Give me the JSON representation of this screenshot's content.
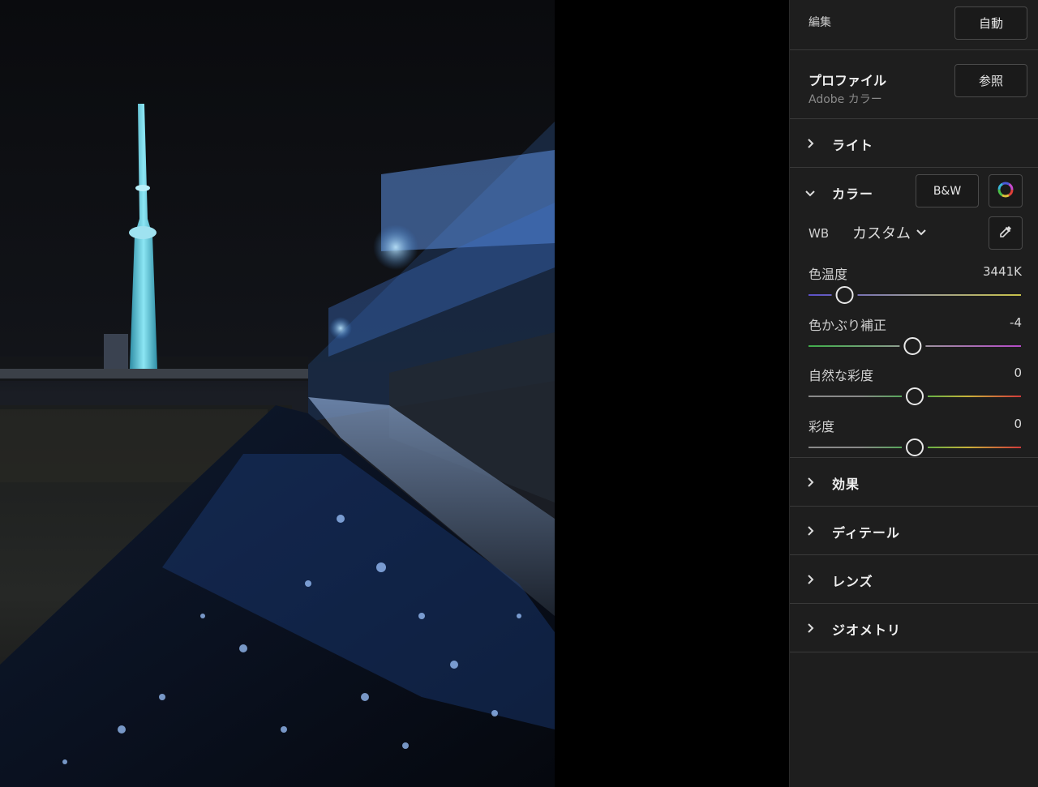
{
  "edit": {
    "title": "編集",
    "auto_label": "自動"
  },
  "profile": {
    "title": "プロファイル",
    "value": "Adobe カラー",
    "browse_label": "参照"
  },
  "sections": {
    "light": "ライト",
    "color": "カラー",
    "effects": "効果",
    "detail": "ディテール",
    "lens": "レンズ",
    "geometry": "ジオメトリ"
  },
  "color": {
    "bw_label": "B&W",
    "mixer_icon": "color-wheel-icon",
    "wb_label": "WB",
    "wb_value": "カスタム",
    "eyedropper_icon": "eyedropper-icon",
    "sliders": [
      {
        "label": "色温度",
        "value": "3441K",
        "position": 0.17,
        "gradient": [
          "#5a4fc8",
          "#9a9a9a",
          "#c8c24a"
        ]
      },
      {
        "label": "色かぶり補正",
        "value": "-4",
        "position": 0.49,
        "gradient": [
          "#3fae4a",
          "#9a9a9a",
          "#b54ac8"
        ]
      },
      {
        "label": "自然な彩度",
        "value": "0",
        "position": 0.5,
        "gradient": [
          "#8a8a8a",
          "#8a8a8a",
          "#46b04a",
          "#c8b23a",
          "#d23a3a"
        ]
      },
      {
        "label": "彩度",
        "value": "0",
        "position": 0.5,
        "gradient": [
          "#8a8a8a",
          "#8a8a8a",
          "#46b04a",
          "#c8b23a",
          "#d23a3a"
        ]
      }
    ]
  },
  "colors": {
    "panel_bg": "#1e1e1e",
    "divider": "#3a3a3a",
    "accent": "#ffffff"
  }
}
